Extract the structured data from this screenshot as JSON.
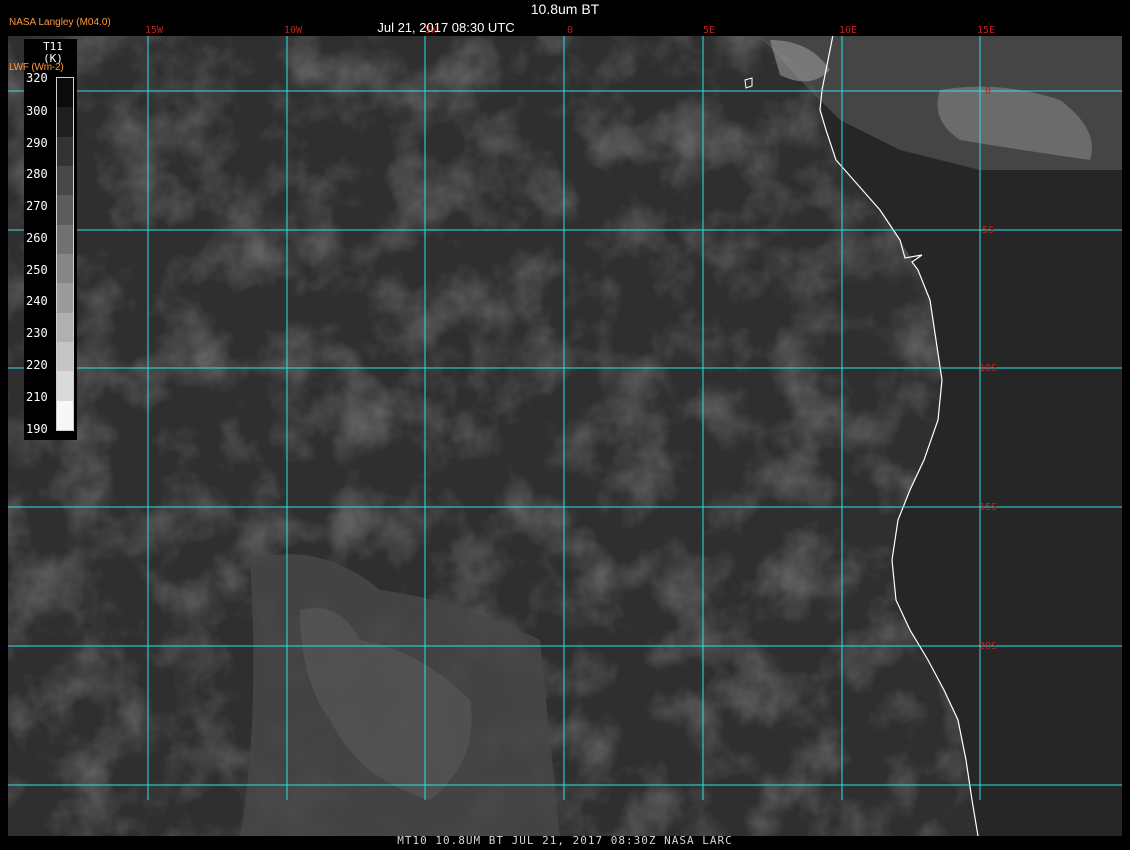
{
  "title": "10.8um BT",
  "date_time": "Jul 21, 2017 08:30 UTC",
  "source": "NASA Langley (M04.0)",
  "overlay_label": "LWF (Wm-2)",
  "footer": "MT10  10.8UM BT   JUL 21, 2017 08:30Z   NASA LARC",
  "legend": {
    "param": "T11",
    "unit": "(K)",
    "ticks": [
      "320",
      "300",
      "290",
      "280",
      "270",
      "260",
      "250",
      "240",
      "230",
      "220",
      "210",
      "190"
    ],
    "shades": [
      "#0b0b0b",
      "#1e1e1e",
      "#333333",
      "#484848",
      "#5c5c5c",
      "#717171",
      "#868686",
      "#9b9b9b",
      "#b0b0b0",
      "#c5c5c5",
      "#dadada",
      "#f7f7f7"
    ]
  },
  "grid": {
    "longitudes": [
      "15W",
      "10W",
      "5W",
      "0",
      "5E",
      "10E",
      "15E"
    ],
    "latitudes": [
      "0",
      "5S",
      "10S",
      "15S",
      "20S"
    ],
    "grid_color": "#27e3ea",
    "label_lon_color": "#c0241d",
    "label_lat_color": "#c0241d"
  },
  "colors": {
    "ocean": "#2f2f2f",
    "land": "#262626",
    "coastline": "#ffffff"
  }
}
